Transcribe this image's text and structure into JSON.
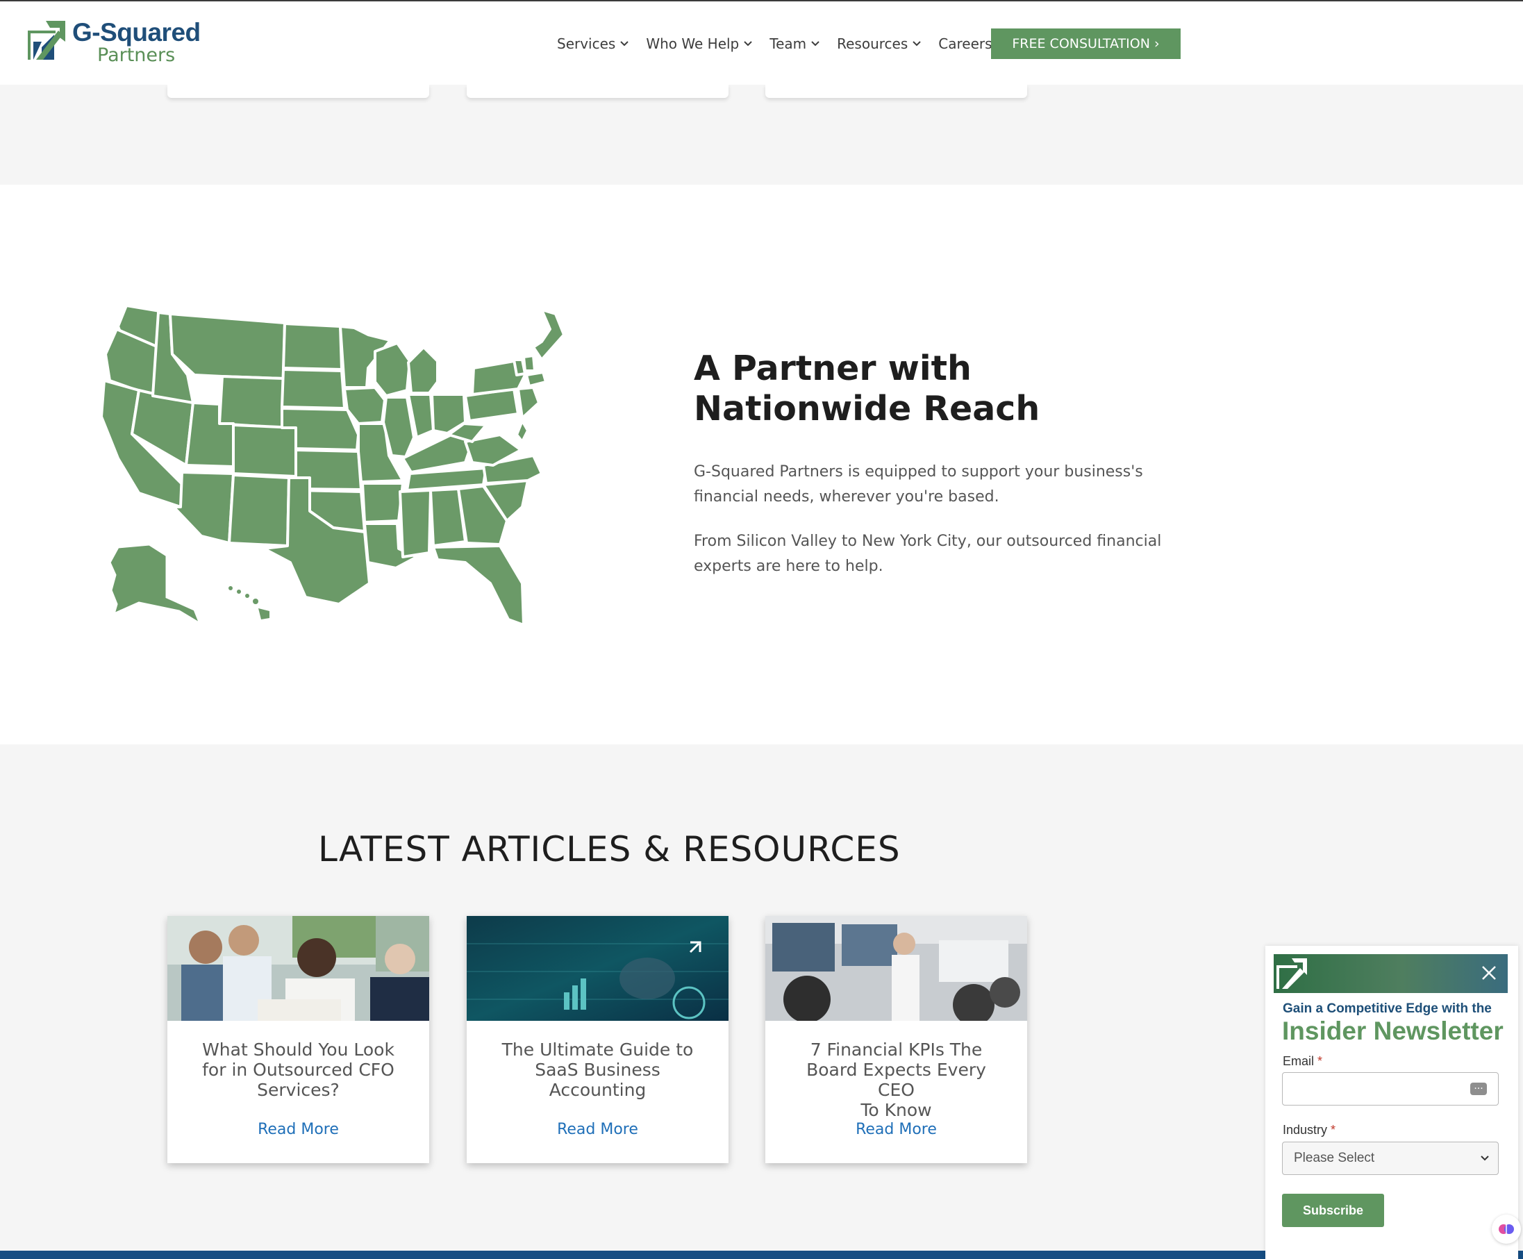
{
  "header": {
    "logo": {
      "name": "G-Squared",
      "sub": "Partners"
    },
    "nav": [
      {
        "label": "Services",
        "has_dropdown": true
      },
      {
        "label": "Who We Help",
        "has_dropdown": true
      },
      {
        "label": "Team",
        "has_dropdown": true
      },
      {
        "label": "Resources",
        "has_dropdown": true
      },
      {
        "label": "Careers",
        "has_dropdown": false
      }
    ],
    "cta_label": "FREE CONSULTATION ›"
  },
  "reach": {
    "heading_line1": "A Partner with",
    "heading_line2": "Nationwide Reach",
    "para1_line1": "G-Squared Partners is equipped to support your business's",
    "para1_line2": "financial needs, wherever you're based.",
    "para2_line1": "From Silicon Valley to New York City, our outsourced financial",
    "para2_line2": "experts are here to help."
  },
  "articles": {
    "title": "LATEST ARTICLES & RESOURCES",
    "cards": [
      {
        "title_lines": [
          "What Should You Look",
          "for in Outsourced CFO",
          "Services?"
        ],
        "link": "Read More"
      },
      {
        "title_lines": [
          "The Ultimate Guide to",
          "SaaS Business",
          "Accounting"
        ],
        "link": "Read More"
      },
      {
        "title_lines": [
          "7 Financial KPIs The",
          "Board Expects Every CEO",
          "To Know"
        ],
        "link": "Read More"
      }
    ]
  },
  "newsletter": {
    "subtitle": "Gain a Competitive Edge with the",
    "title": "Insider Newsletter",
    "email_label": "Email",
    "industry_label": "Industry",
    "required_mark": "*",
    "select_value": "Please Select",
    "button_label": "Subscribe"
  },
  "colors": {
    "brand_green": "#5f9660",
    "brand_blue": "#1f4e79",
    "link_blue": "#1f6fb8",
    "footer_blue": "#164d82"
  }
}
